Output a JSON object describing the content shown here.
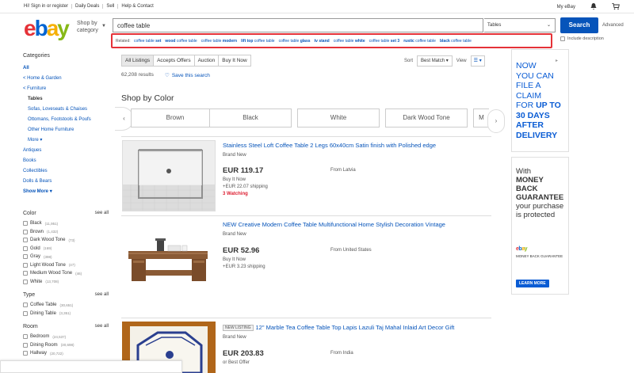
{
  "topbar": {
    "greeting": "Hi! Sign in or register",
    "daily_deals": "Daily Deals",
    "sell": "Sell",
    "help": "Help & Contact",
    "my_ebay": "My eBay"
  },
  "header": {
    "logo": {
      "e": "e",
      "b": "b",
      "a": "a",
      "y": "y"
    },
    "shop_by_line1": "Shop by",
    "shop_by_line2": "category",
    "search_value": "coffee table",
    "category_selected": "Tables",
    "search_button": "Search",
    "advanced": "Advanced",
    "include_description": "Include description"
  },
  "related": {
    "label": "Related:",
    "items": [
      {
        "prefix": "coffee table ",
        "bold": "set"
      },
      {
        "prefix": "",
        "bold": "wood",
        "suffix": " coffee table"
      },
      {
        "prefix": "coffee table ",
        "bold": "modern"
      },
      {
        "prefix": "",
        "bold": "lift top",
        "suffix": " coffee table"
      },
      {
        "prefix": "coffee table ",
        "bold": "glass"
      },
      {
        "prefix": "",
        "bold": "tv stand"
      },
      {
        "prefix": "coffee table ",
        "bold": "white"
      },
      {
        "prefix": "coffee table ",
        "bold": "set 3"
      },
      {
        "prefix": "",
        "bold": "rustic",
        "suffix": " coffee table"
      },
      {
        "prefix": "",
        "bold": "black",
        "suffix": " coffee table"
      }
    ]
  },
  "sidebar": {
    "title": "Categories",
    "all": "All",
    "home_garden": "< Home & Garden",
    "furniture": "< Furniture",
    "tables": "Tables",
    "subcats": [
      "Sofas, Loveseats & Chaises",
      "Ottomans, Footstools & Poufs",
      "Other Home Furniture"
    ],
    "more": "More",
    "others": [
      "Antiques",
      "Books",
      "Collectibles",
      "Dolls & Bears"
    ],
    "show_more": "Show More"
  },
  "filters": {
    "see_all": "see all",
    "color": {
      "title": "Color",
      "items": [
        {
          "name": "Black",
          "count": "(11,951)"
        },
        {
          "name": "Brown",
          "count": "(1,432)"
        },
        {
          "name": "Dark Wood Tone",
          "count": "(73)"
        },
        {
          "name": "Gold",
          "count": "(169)"
        },
        {
          "name": "Gray",
          "count": "(398)"
        },
        {
          "name": "Light Wood Tone",
          "count": "(47)"
        },
        {
          "name": "Medium Wood Tone",
          "count": "(46)"
        },
        {
          "name": "White",
          "count": "(13,708)"
        }
      ]
    },
    "type": {
      "title": "Type",
      "items": [
        {
          "name": "Coffee Table",
          "count": "(30,651)"
        },
        {
          "name": "Dining Table",
          "count": "(3,351)"
        }
      ]
    },
    "room": {
      "title": "Room",
      "items": [
        {
          "name": "Bedroom",
          "count": "(24,537)"
        },
        {
          "name": "Dining Room",
          "count": "(30,698)"
        },
        {
          "name": "Hallway",
          "count": "(20,722)"
        }
      ]
    }
  },
  "toolbar": {
    "tabs": [
      "All Listings",
      "Accepts Offers",
      "Auction",
      "Buy It Now"
    ],
    "sort_label": "Sort",
    "sort_value": "Best Match",
    "view_label": "View",
    "result_count": "62,208 results",
    "save_search": "Save this search"
  },
  "shop_by_color": {
    "title": "Shop by Color",
    "colors": [
      "Brown",
      "Black",
      "White",
      "Dark Wood Tone",
      "M"
    ]
  },
  "listings": [
    {
      "title": "Stainless Steel Loft Coffee Table 2 Legs 60x40cm Satin finish with Polished edge",
      "condition": "Brand New",
      "price": "EUR 119.17",
      "from": "From Latvia",
      "format": "Buy It Now",
      "shipping": "+EUR 22.07 shipping",
      "watching": "3 Watching"
    },
    {
      "title": "NEW Creative Modern Coffee Table Multifunctional Home Stylish Decoration Vintage",
      "condition": "Brand New",
      "price": "EUR 52.96",
      "from": "From United States",
      "format": "Buy It Now",
      "shipping": "+EUR 3.23 shipping"
    },
    {
      "badge": "NEW LISTING",
      "title": "12\" Marble Tea Coffee Table Top Lapis Lazuli Taj Mahal Inlaid Art Decor Gift",
      "condition": "Brand New",
      "price": "EUR 203.83",
      "from": "From India",
      "format": "or Best Offer"
    }
  ],
  "ads": {
    "ad1_l1": "NOW",
    "ad1_l2": "YOU CAN",
    "ad1_l3": "FILE A",
    "ad1_l4": "CLAIM",
    "ad1_l5a": "FOR ",
    "ad1_l5b": "UP TO",
    "ad1_l6": "30 DAYS",
    "ad1_l7": "AFTER",
    "ad1_l8": "DELIVERY",
    "ad2_l1": "With",
    "ad2_l2": "MONEY",
    "ad2_l3": "BACK",
    "ad2_l4": "GUARANTEE",
    "ad2_l5": "your purchase",
    "ad2_l6": "is protected",
    "ad2_small": "MONEY BACK GUARANTEE",
    "learn_more": "LEARN MORE"
  },
  "colors": {
    "link": "#0654ba",
    "search_button": "#0654ba",
    "highlight_border": "#e53238",
    "watching": "#dd1e31",
    "ad_blue": "#0a5cd4"
  }
}
